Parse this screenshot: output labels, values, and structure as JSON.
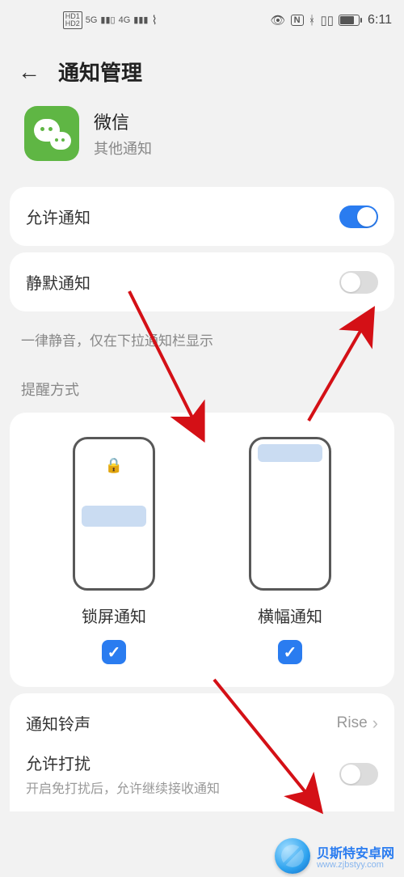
{
  "status": {
    "hd1": "HD1",
    "hd2": "HD2",
    "net1": "5G",
    "net2": "4G",
    "time": "6:11"
  },
  "header": {
    "title": "通知管理"
  },
  "app": {
    "name": "微信",
    "subtitle": "其他通知"
  },
  "allow": {
    "label": "允许通知",
    "on": true
  },
  "silent": {
    "label": "静默通知",
    "on": false,
    "hint": "一律静音，仅在下拉通知栏显示"
  },
  "methods": {
    "title": "提醒方式",
    "lock": {
      "label": "锁屏通知",
      "checked": true
    },
    "banner": {
      "label": "横幅通知",
      "checked": true
    }
  },
  "ringtone": {
    "label": "通知铃声",
    "value": "Rise"
  },
  "disturb": {
    "label": "允许打扰",
    "sub": "开启免打扰后，允许继续接收通知",
    "on": false
  },
  "watermark": {
    "brand": "贝斯特安卓网",
    "url": "www.zjbstyy.com"
  }
}
